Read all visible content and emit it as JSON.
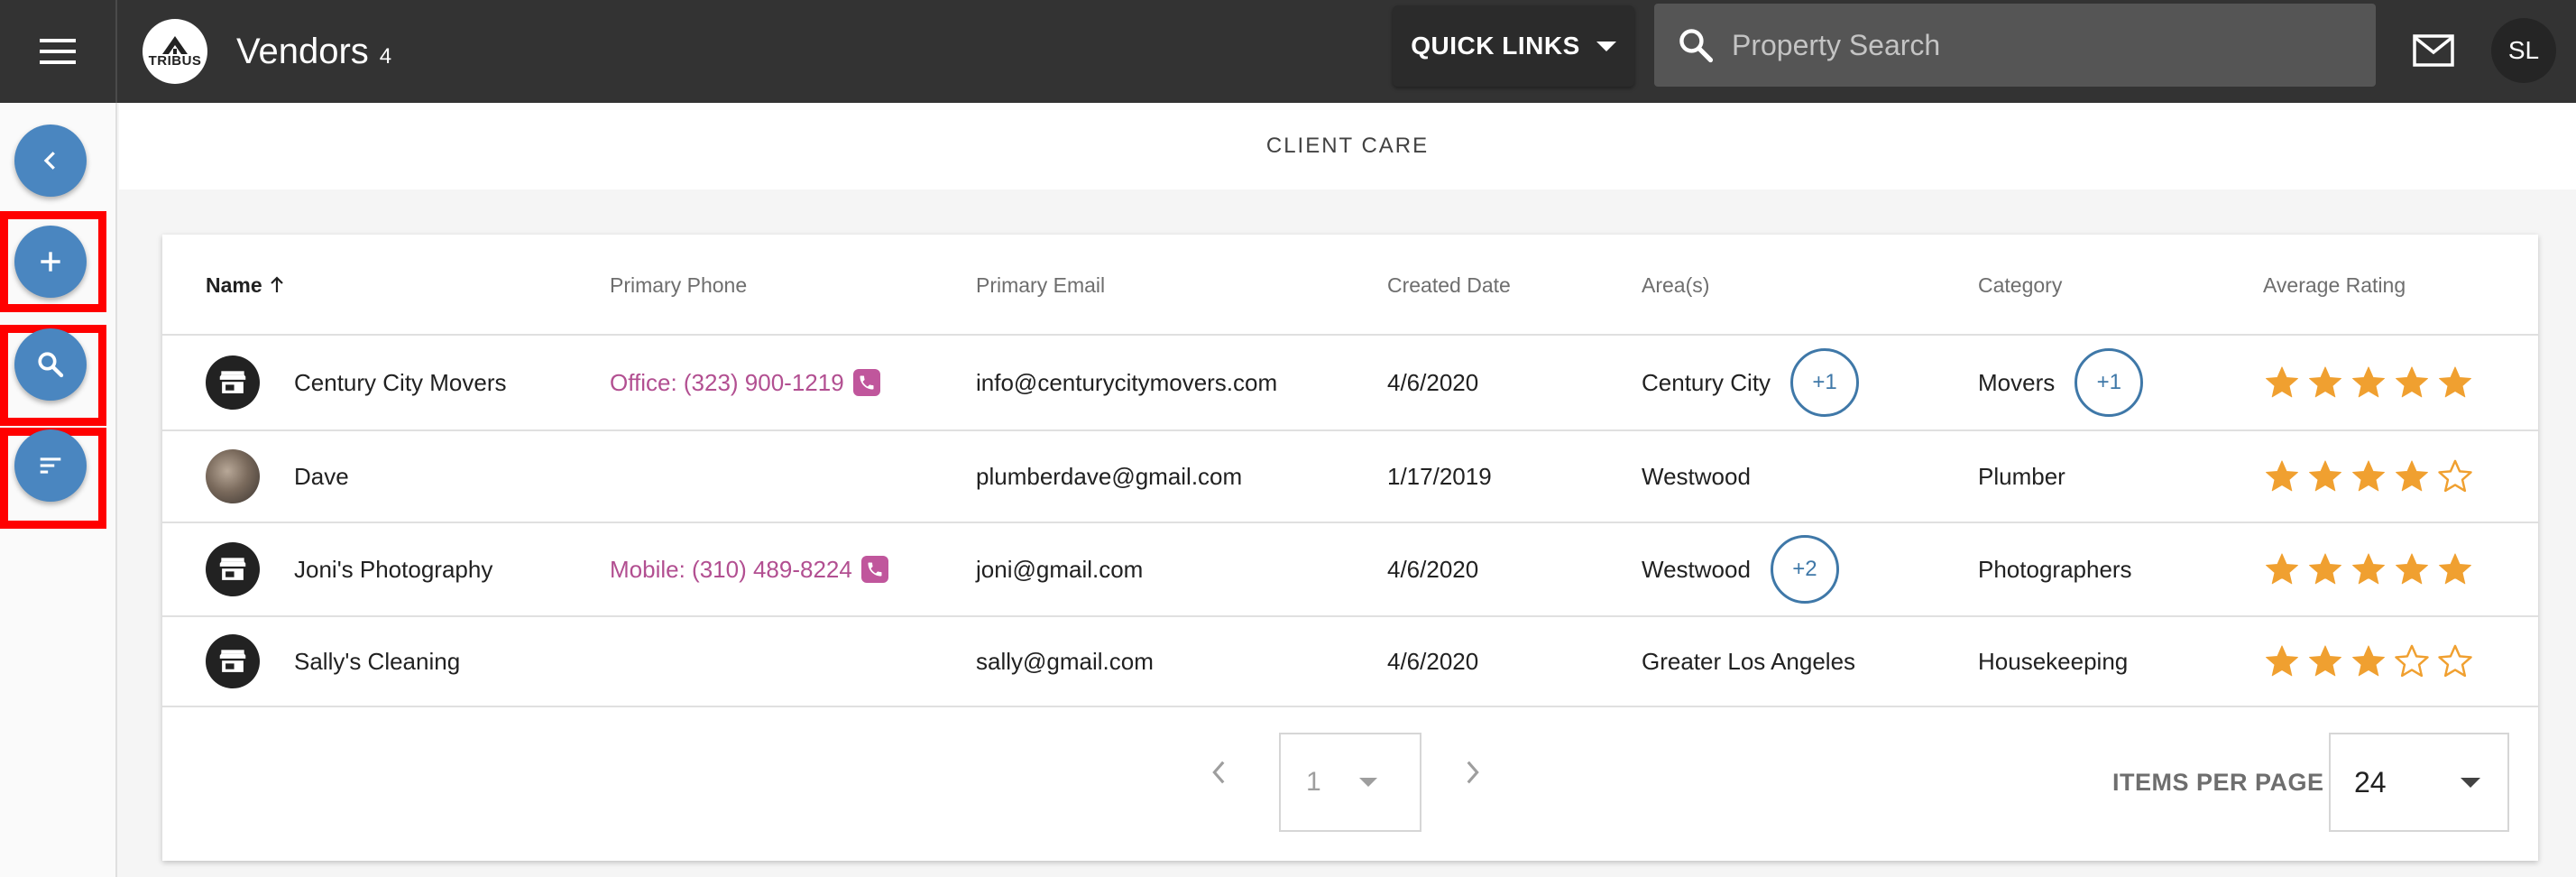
{
  "header": {
    "logo_text": "TRIBUS",
    "title": "Vendors",
    "count": "4",
    "quick_links_label": "QUICK LINKS",
    "search_placeholder": "Property Search",
    "user_initials": "SL"
  },
  "subheader": {
    "label": "CLIENT CARE"
  },
  "table": {
    "columns": {
      "name": "Name",
      "phone": "Primary Phone",
      "email": "Primary Email",
      "created": "Created Date",
      "areas": "Area(s)",
      "category": "Category",
      "rating": "Average Rating"
    },
    "sort": {
      "column": "name",
      "direction": "ascending"
    },
    "rows": [
      {
        "name": "Century City Movers",
        "avatar": "store-icon",
        "phone": "Office: (323) 900-1219",
        "email": "info@centurycitymovers.com",
        "created": "4/6/2020",
        "area": "Century City",
        "area_more": "+1",
        "category": "Movers",
        "category_more": "+1",
        "rating": 5
      },
      {
        "name": "Dave",
        "avatar": "photo",
        "phone": "",
        "email": "plumberdave@gmail.com",
        "created": "1/17/2019",
        "area": "Westwood",
        "area_more": "",
        "category": "Plumber",
        "category_more": "",
        "rating": 4
      },
      {
        "name": "Joni's Photography",
        "avatar": "store-icon",
        "phone": "Mobile: (310) 489-8224",
        "email": "joni@gmail.com",
        "created": "4/6/2020",
        "area": "Westwood",
        "area_more": "+2",
        "category": "Photographers",
        "category_more": "",
        "rating": 5
      },
      {
        "name": "Sally's Cleaning",
        "avatar": "store-icon",
        "phone": "",
        "email": "sally@gmail.com",
        "created": "4/6/2020",
        "area": "Greater Los Angeles",
        "area_more": "",
        "category": "Housekeeping",
        "category_more": "",
        "rating": 3
      }
    ]
  },
  "pagination": {
    "page": "1",
    "items_per_page_label": "ITEMS PER PAGE",
    "items_per_page": "24"
  },
  "sidebar": {
    "buttons": [
      "back-icon",
      "add-icon",
      "search-icon",
      "sort-icon"
    ]
  },
  "colors": {
    "topbar": "#333333",
    "fab": "#4a86c0",
    "phone_link": "#b24f91",
    "chip": "#3f78a8",
    "star": "#f0a030",
    "highlight_frame": "#ff0000"
  }
}
